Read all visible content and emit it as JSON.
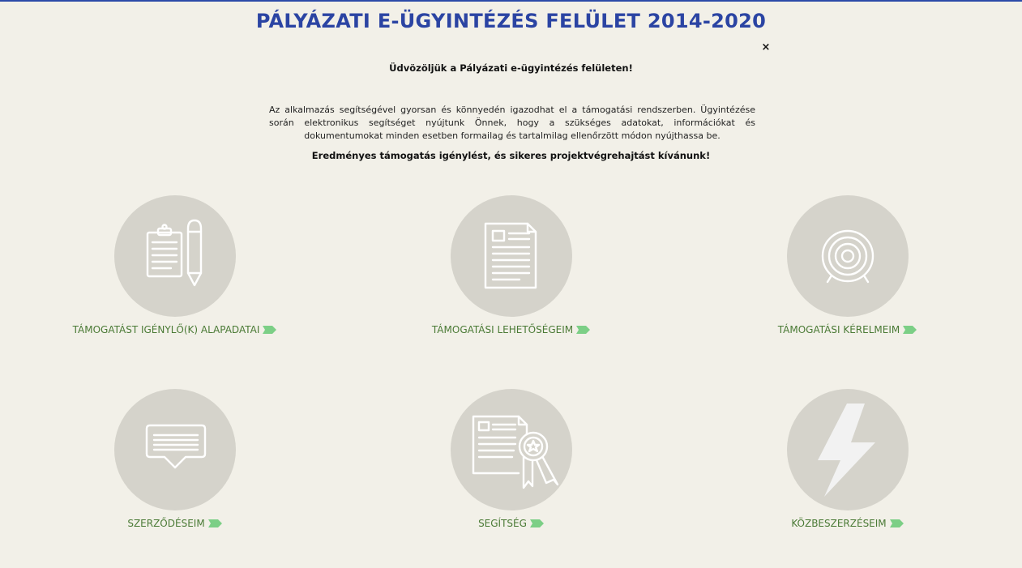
{
  "header": {
    "title": "PÁLYÁZATI E-ÜGYINTÉZÉS FELÜLET 2014-2020",
    "close_symbol": "×"
  },
  "welcome": {
    "title": "Üdvözöljük a Pályázati e-ügyintézés felületen!",
    "intro": "Az alkalmazás segítségével gyorsan és könnyedén igazodhat el a támogatási rendszerben. Ügyintézése során elektronikus segítséget nyújtunk Önnek, hogy a szükséges adatokat, információkat és dokumentumokat minden esetben formailag és tartalmilag ellenőrzött módon nyújthassa be.",
    "wish": "Eredményes támogatás igénylést, és sikeres projektvégrehajtást kívánunk!"
  },
  "tiles": [
    {
      "label": "TÁMOGATÁST IGÉNYLŐ(K) ALAPADATAI",
      "icon": "clipboard-pencil-icon"
    },
    {
      "label": "TÁMOGATÁSI LEHETŐSÉGEIM",
      "icon": "document-icon"
    },
    {
      "label": "TÁMOGATÁSI KÉRELMEIM",
      "icon": "target-icon"
    },
    {
      "label": "SZERZŐDÉSEIM",
      "icon": "speech-bubble-icon"
    },
    {
      "label": "SEGÍTSÉG",
      "icon": "certificate-icon"
    },
    {
      "label": "KÖZBESZERZÉSEIM",
      "icon": "lightning-icon"
    }
  ],
  "colors": {
    "title": "#2b44a3",
    "link": "#4a7a35",
    "arrow": "#7ccf86",
    "circle": "#d5d3cb",
    "background": "#f2f0e8"
  }
}
